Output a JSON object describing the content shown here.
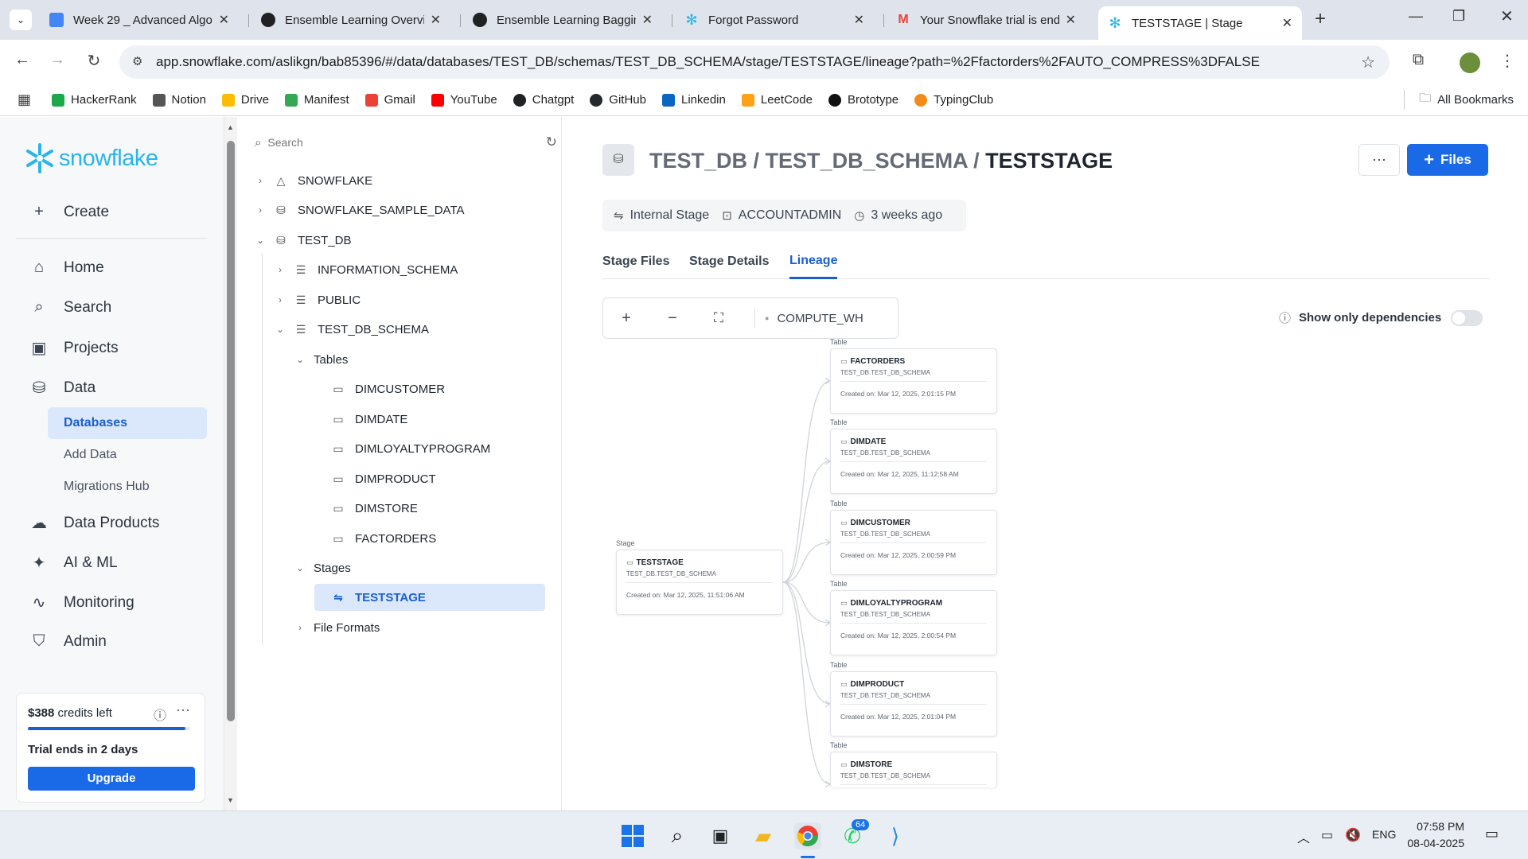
{
  "browser": {
    "tabs": [
      {
        "title": "Week 29 _ Advanced Algor",
        "icon": "docs-icon",
        "color": "#4285f4"
      },
      {
        "title": "Ensemble Learning Overvie",
        "icon": "chatgpt-icon",
        "color": "#202123"
      },
      {
        "title": "Ensemble Learning Baggin",
        "icon": "chatgpt-icon",
        "color": "#202123"
      },
      {
        "title": "Forgot Password",
        "icon": "snowflake-icon",
        "color": "#29b5e8"
      },
      {
        "title": "Your Snowflake trial is end",
        "icon": "gmail-icon",
        "color": "#ea4335"
      },
      {
        "title": "TESTSTAGE | Stage",
        "icon": "snowflake-icon",
        "color": "#29b5e8"
      }
    ],
    "url": "app.snowflake.com/aslikgn/bab85396/#/data/databases/TEST_DB/schemas/TEST_DB_SCHEMA/stage/TESTSTAGE/lineage?path=%2Ffactorders%2FAUTO_COMPRESS%3DFALSE",
    "bookmarks": [
      {
        "label": "HackerRank",
        "color": "#1ba94c"
      },
      {
        "label": "Notion",
        "color": "#555555"
      },
      {
        "label": "Drive",
        "color": "#fbbc04"
      },
      {
        "label": "Manifest",
        "color": "#34a853"
      },
      {
        "label": "Gmail",
        "color": "#ea4335"
      },
      {
        "label": "YouTube",
        "color": "#ff0000"
      },
      {
        "label": "Chatgpt",
        "color": "#202123"
      },
      {
        "label": "GitHub",
        "color": "#24292e"
      },
      {
        "label": "Linkedin",
        "color": "#0a66c2"
      },
      {
        "label": "LeetCode",
        "color": "#ffa116"
      },
      {
        "label": "Brototype",
        "color": "#111111"
      },
      {
        "label": "TypingClub",
        "color": "#f28b1a"
      }
    ],
    "all_bookmarks": "All Bookmarks"
  },
  "sidebar": {
    "logo": "snowflake",
    "create": "Create",
    "nav": [
      {
        "label": "Home",
        "icon": "home-icon"
      },
      {
        "label": "Search",
        "icon": "search-icon"
      },
      {
        "label": "Projects",
        "icon": "projects-icon"
      },
      {
        "label": "Data",
        "icon": "database-icon"
      }
    ],
    "data_sub": [
      "Databases",
      "Add Data",
      "Migrations Hub"
    ],
    "nav2": [
      {
        "label": "Data Products",
        "icon": "cloud-icon"
      },
      {
        "label": "AI & ML",
        "icon": "sparkle-icon"
      },
      {
        "label": "Monitoring",
        "icon": "pulse-icon"
      },
      {
        "label": "Admin",
        "icon": "shield-icon"
      }
    ],
    "credits": {
      "amount": "$388",
      "suffix": " credits left",
      "trial": "Trial ends in 2 days",
      "upgrade": "Upgrade",
      "progress": 0.97
    }
  },
  "tree": {
    "search_placeholder": "Search",
    "items": [
      {
        "label": "SNOWFLAKE"
      },
      {
        "label": "SNOWFLAKE_SAMPLE_DATA"
      },
      {
        "label": "TEST_DB"
      },
      {
        "label": "INFORMATION_SCHEMA"
      },
      {
        "label": "PUBLIC"
      },
      {
        "label": "TEST_DB_SCHEMA"
      },
      {
        "label": "Tables"
      },
      {
        "label": "DIMCUSTOMER"
      },
      {
        "label": "DIMDATE"
      },
      {
        "label": "DIMLOYALTYPROGRAM"
      },
      {
        "label": "DIMPRODUCT"
      },
      {
        "label": "DIMSTORE"
      },
      {
        "label": "FACTORDERS"
      },
      {
        "label": "Stages"
      },
      {
        "label": "TESTSTAGE"
      },
      {
        "label": "File Formats"
      }
    ]
  },
  "main": {
    "crumb_db": "TEST_DB",
    "crumb_sep": " / ",
    "crumb_schema": "TEST_DB_SCHEMA",
    "crumb_stage": "TESTSTAGE",
    "more": "···",
    "files_button": "Files",
    "meta": {
      "type": "Internal Stage",
      "owner": "ACCOUNTADMIN",
      "age": "3 weeks ago"
    },
    "tabs": [
      "Stage Files",
      "Stage Details",
      "Lineage"
    ],
    "warehouse": "COMPUTE_WH",
    "show_dependencies": "Show only dependencies",
    "source": {
      "kind": "Stage",
      "name": "TESTSTAGE",
      "schema": "TEST_DB.TEST_DB_SCHEMA",
      "created": "Created on: Mar 12, 2025, 11:51:06 AM"
    },
    "targets": [
      {
        "kind": "Table",
        "name": "FACTORDERS",
        "schema": "TEST_DB.TEST_DB_SCHEMA",
        "created": "Created on: Mar 12, 2025, 2:01:15 PM"
      },
      {
        "kind": "Table",
        "name": "DIMDATE",
        "schema": "TEST_DB.TEST_DB_SCHEMA",
        "created": "Created on: Mar 12, 2025, 11:12:58 AM"
      },
      {
        "kind": "Table",
        "name": "DIMCUSTOMER",
        "schema": "TEST_DB.TEST_DB_SCHEMA",
        "created": "Created on: Mar 12, 2025, 2:00:59 PM"
      },
      {
        "kind": "Table",
        "name": "DIMLOYALTYPROGRAM",
        "schema": "TEST_DB.TEST_DB_SCHEMA",
        "created": "Created on: Mar 12, 2025, 2:00:54 PM"
      },
      {
        "kind": "Table",
        "name": "DIMPRODUCT",
        "schema": "TEST_DB.TEST_DB_SCHEMA",
        "created": "Created on: Mar 12, 2025, 2:01:04 PM"
      },
      {
        "kind": "Table",
        "name": "DIMSTORE",
        "schema": "TEST_DB.TEST_DB_SCHEMA",
        "created": ""
      }
    ]
  },
  "taskbar": {
    "badge": "64",
    "lang": "ENG",
    "time": "07:58 PM",
    "date": "08-04-2025"
  }
}
